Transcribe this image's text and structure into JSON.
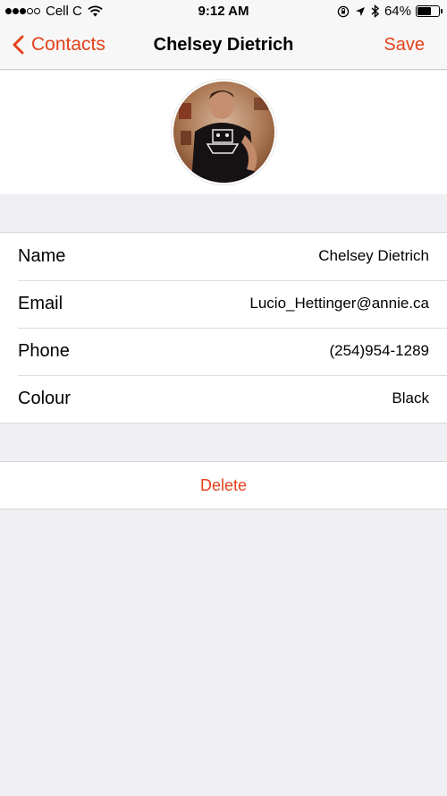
{
  "status_bar": {
    "carrier": "Cell C",
    "time": "9:12 AM",
    "battery": "64%",
    "battery_level": 0.64,
    "signal_bars_filled": 3,
    "signal_bars_total": 5
  },
  "nav": {
    "back_label": "Contacts",
    "title": "Chelsey Dietrich",
    "save_label": "Save"
  },
  "fields": [
    {
      "label": "Name",
      "value": "Chelsey Dietrich"
    },
    {
      "label": "Email",
      "value": "Lucio_Hettinger@annie.ca"
    },
    {
      "label": "Phone",
      "value": "(254)954-1289"
    },
    {
      "label": "Colour",
      "value": "Black"
    }
  ],
  "delete_label": "Delete",
  "colors": {
    "accent": "#e4411b",
    "background": "#efeff4"
  },
  "icons": [
    "wifi-icon",
    "orientation-lock-icon",
    "location-arrow-icon",
    "bluetooth-icon",
    "battery-icon",
    "chevron-left-icon"
  ]
}
